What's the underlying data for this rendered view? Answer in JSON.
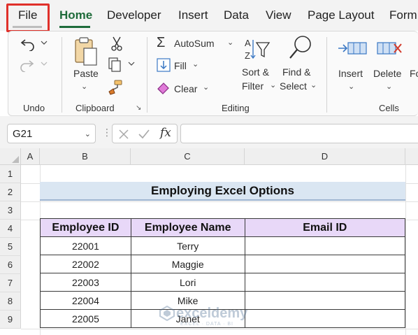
{
  "menu": {
    "tabs": [
      "File",
      "Home",
      "Developer",
      "Insert",
      "Data",
      "View",
      "Page Layout",
      "Form"
    ],
    "active_tab": "Home",
    "highlighted_tab": "File"
  },
  "ribbon": {
    "undo_group_label": "Undo",
    "clipboard": {
      "paste_label": "Paste",
      "group_label": "Clipboard"
    },
    "editing": {
      "autosum_label": "AutoSum",
      "fill_label": "Fill",
      "clear_label": "Clear",
      "sort_line1": "Sort &",
      "sort_line2": "Filter",
      "find_line1": "Find &",
      "find_line2": "Select",
      "group_label": "Editing"
    },
    "cells": {
      "insert_label": "Insert",
      "delete_label": "Delete",
      "format_label_partial": "Fo",
      "group_label": "Cells"
    }
  },
  "formula_bar": {
    "name_box": "G21",
    "fx_label": "fx",
    "formula": ""
  },
  "sheet": {
    "columns": [
      "A",
      "B",
      "C",
      "D"
    ],
    "rows": [
      "1",
      "2",
      "3",
      "4",
      "5",
      "6",
      "7",
      "8",
      "9"
    ],
    "title": "Employing Excel Options",
    "table": {
      "headers": [
        "Employee ID",
        "Employee Name",
        "Email ID"
      ],
      "rows": [
        [
          "22001",
          "Terry",
          ""
        ],
        [
          "22002",
          "Maggie",
          ""
        ],
        [
          "22003",
          "Lori",
          ""
        ],
        [
          "22004",
          "Mike",
          ""
        ],
        [
          "22005",
          "Janet",
          ""
        ]
      ]
    }
  },
  "watermark": {
    "name": "exceldemy",
    "tagline": "EXCEL · DATA · BI"
  },
  "colors": {
    "accent_green": "#1e6b3a",
    "file_highlight": "#e0302a",
    "title_fill": "#dae6f2",
    "header_fill": "#e8d8f8"
  }
}
